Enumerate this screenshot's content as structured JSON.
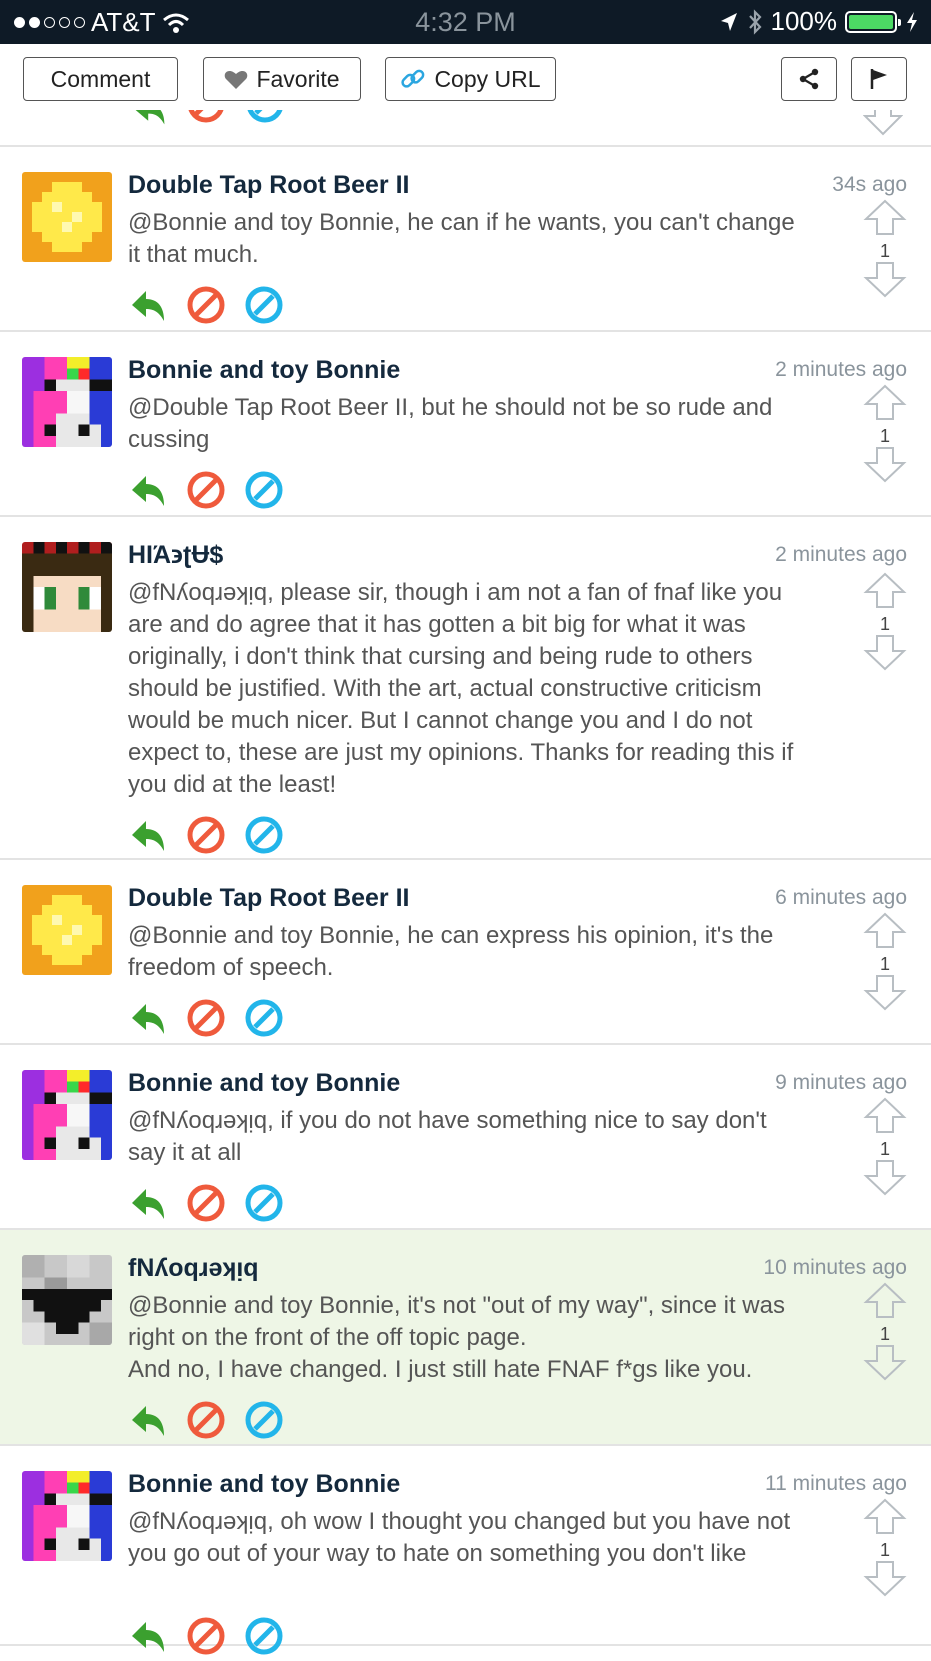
{
  "status": {
    "carrier": "AT&T",
    "time": "4:32 PM",
    "battery": "100%"
  },
  "toolbar": {
    "comment_label": "Comment",
    "favorite_label": "Favorite",
    "copy_url_label": "Copy URL"
  },
  "comments": [
    {
      "author": "Double Tap Root Beer II",
      "time": "34s ago",
      "text": "@Bonnie and toy Bonnie, he can if he wants, you can't change it that much.",
      "votes": "1",
      "avatar": "sun-avatar"
    },
    {
      "author": "Bonnie and toy Bonnie",
      "time": "2 minutes ago",
      "text": "@Double Tap Root Beer II, but he should not be so rude and cussing",
      "votes": "1",
      "avatar": "bonnie-avatar"
    },
    {
      "author": "ΗΙΆ϶ʈɄ$",
      "time": "2 minutes ago",
      "text": "@fNʎoqɹǝʞᴉq, please sir, though i am not a fan of fnaf like you are and do agree that it has gotten a bit big for what it was originally, i don't think that cursing and being rude to others should be justified. With the art, actual constructive criticism would be much nicer. But I cannot change you and I do not expect to, these are just my opinions. Thanks for reading this if you did at the least!",
      "votes": "1",
      "avatar": "face-avatar"
    },
    {
      "author": "Double Tap Root Beer II",
      "time": "6 minutes ago",
      "text": "@Bonnie and toy Bonnie, he can express his opinion, it's the freedom of speech.",
      "votes": "1",
      "avatar": "sun-avatar"
    },
    {
      "author": "Bonnie and toy Bonnie",
      "time": "9 minutes ago",
      "text": "@fNʎoqɹǝʞᴉq, if you do not have something nice to say don't say it at all",
      "votes": "1",
      "avatar": "bonnie-avatar"
    },
    {
      "author": "fNʎoqɹǝʞᴉq",
      "time": "10 minutes ago",
      "text": "@Bonnie and toy Bonnie, it's not \"out of my way\", since it was right on the front of the off topic page.\nAnd no, I have changed. I just still hate FNAF f*gs like you.",
      "votes": "1",
      "avatar": "mask-avatar"
    },
    {
      "author": "Bonnie and toy Bonnie",
      "time": "11 minutes ago",
      "text": "@fNʎoqɹǝʞᴉq, oh wow I thought you changed but you have not you go out of your way to hate on something you don't like",
      "votes": "1",
      "avatar": "bonnie-avatar"
    }
  ]
}
